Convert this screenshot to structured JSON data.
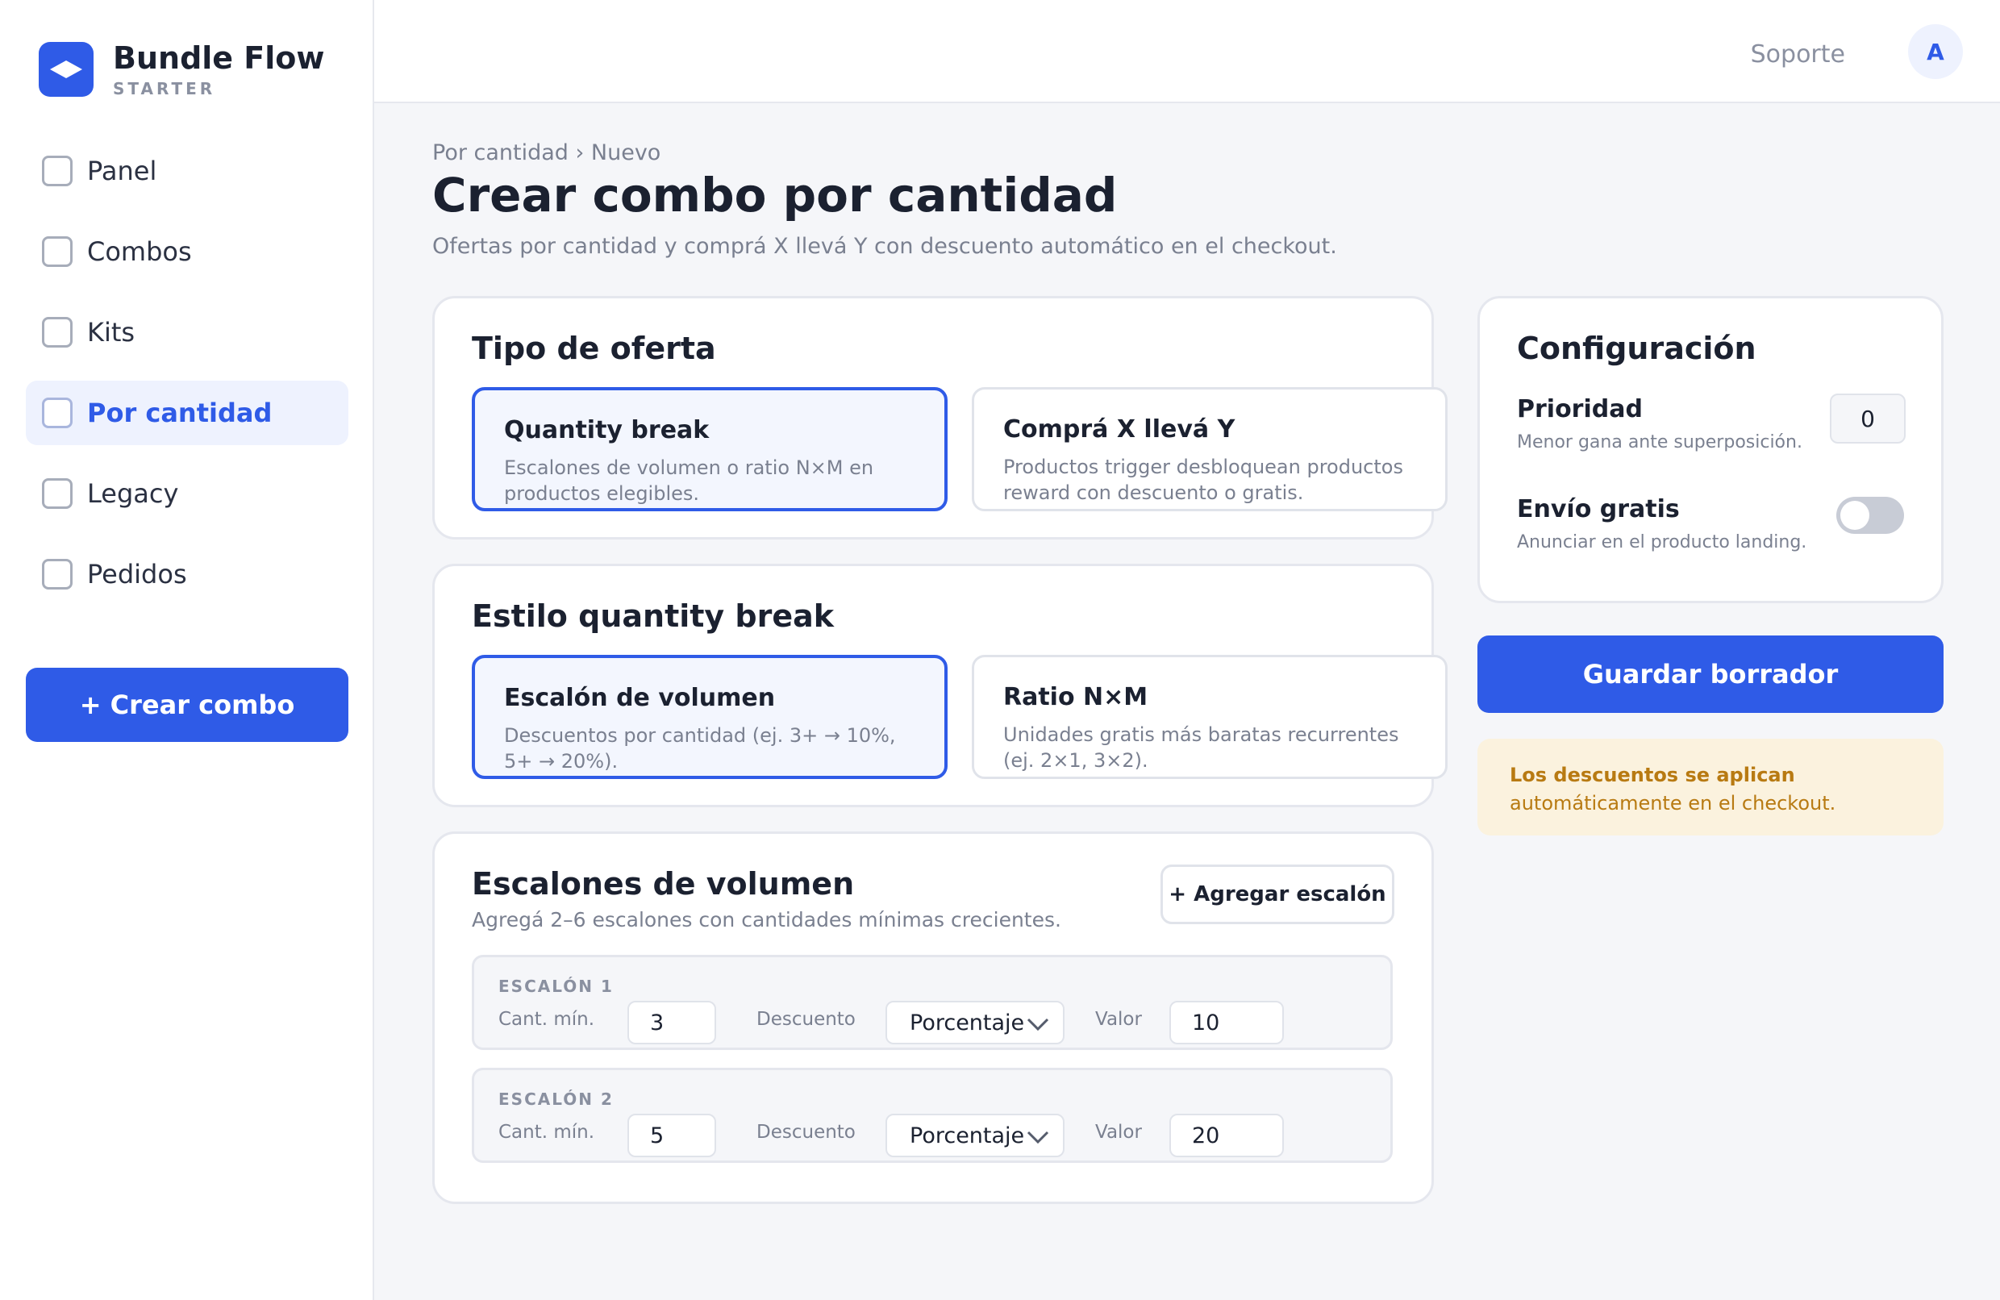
{
  "brand": {
    "name": "Bundle Flow",
    "plan": "STARTER"
  },
  "sidebar": {
    "items": [
      {
        "label": "Panel",
        "active": false
      },
      {
        "label": "Combos",
        "active": false
      },
      {
        "label": "Kits",
        "active": false
      },
      {
        "label": "Por cantidad",
        "active": true
      },
      {
        "label": "Legacy",
        "active": false
      },
      {
        "label": "Pedidos",
        "active": false
      }
    ],
    "create_label": "+ Crear combo"
  },
  "topbar": {
    "support": "Soporte",
    "avatar_initial": "A"
  },
  "header": {
    "breadcrumb": "Por cantidad › Nuevo",
    "title": "Crear combo por cantidad",
    "subtitle": "Ofertas por cantidad y comprá X llevá Y con descuento automático en el checkout."
  },
  "offer_type": {
    "title": "Tipo de oferta",
    "options": [
      {
        "title": "Quantity break",
        "desc": "Escalones de volumen o ratio N×M en productos elegibles.",
        "selected": true
      },
      {
        "title": "Comprá X llevá Y",
        "desc": "Productos trigger desbloquean productos reward con descuento o gratis.",
        "selected": false
      }
    ]
  },
  "style": {
    "title": "Estilo quantity break",
    "options": [
      {
        "title": "Escalón de volumen",
        "desc": "Descuentos por cantidad (ej. 3+ → 10%, 5+ → 20%).",
        "selected": true
      },
      {
        "title": "Ratio N×M",
        "desc": "Unidades gratis más baratas recurrentes (ej. 2×1, 3×2).",
        "selected": false
      }
    ]
  },
  "tiers": {
    "title": "Escalones de volumen",
    "subtitle": "Agregá 2–6 escalones con cantidades mínimas crecientes.",
    "add_label": "+ Agregar escalón",
    "min_qty_label": "Cant. mín.",
    "discount_label": "Descuento",
    "value_label": "Valor",
    "rows": [
      {
        "label": "ESCALÓN 1",
        "min_qty": "3",
        "discount_type": "Porcentaje",
        "value": "10"
      },
      {
        "label": "ESCALÓN 2",
        "min_qty": "5",
        "discount_type": "Porcentaje",
        "value": "20"
      }
    ]
  },
  "config": {
    "title": "Configuración",
    "priority": {
      "label": "Prioridad",
      "help": "Menor gana ante superposición.",
      "value": "0"
    },
    "free_shipping": {
      "label": "Envío gratis",
      "help": "Anunciar en el producto landing.",
      "enabled": false
    }
  },
  "save_label": "Guardar borrador",
  "notice": {
    "strong": "Los descuentos se aplican",
    "rest": "automáticamente en el checkout."
  },
  "colors": {
    "accent": "#2f5be7",
    "notice_bg": "#fbf2de",
    "notice_text": "#b87a12"
  }
}
